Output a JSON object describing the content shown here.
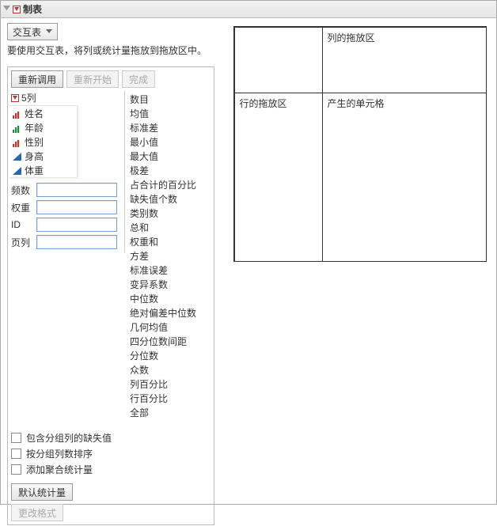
{
  "title": "制表",
  "tableTypeLabel": "交互表",
  "hint": "要使用交互表，将列或统计量拖放到拖放区中。",
  "buttons": {
    "rerun": "重新调用",
    "restart": "重新开始",
    "done": "完成",
    "defaultStats": "默认统计量",
    "changeFormat": "更改格式"
  },
  "colHeaderCount": "5列",
  "columns": [
    {
      "label": "姓名",
      "iconType": "bar",
      "iconColor": "#c0392b"
    },
    {
      "label": "年龄",
      "iconType": "bar",
      "iconColor": "#1e8a3b"
    },
    {
      "label": "性别",
      "iconType": "bar",
      "iconColor": "#c0392b"
    },
    {
      "label": "身高",
      "iconType": "tri",
      "iconColor": "#2766b0"
    },
    {
      "label": "体重",
      "iconType": "tri",
      "iconColor": "#2766b0"
    }
  ],
  "stats": [
    "数目",
    "均值",
    "标准差",
    "最小值",
    "最大值",
    "极差",
    "占合计的百分比",
    "缺失值个数",
    "类别数",
    "总和",
    "权重和",
    "方差",
    "标准误差",
    "变异系数",
    "中位数",
    "绝对偏差中位数",
    "几何均值",
    "四分位数间距",
    "分位数",
    "众数",
    "列百分比",
    "行百分比",
    "全部"
  ],
  "fields": {
    "freq": "频数",
    "weight": "权重",
    "id": "ID",
    "page": "页列"
  },
  "checks": {
    "includeMissing": "包含分组列的缺失值",
    "sortByGroup": "按分组列数排序",
    "addAggStat": "添加聚合统计量"
  },
  "dropZones": {
    "cols": "列的拖放区",
    "rows": "行的拖放区",
    "cells": "产生的单元格"
  }
}
